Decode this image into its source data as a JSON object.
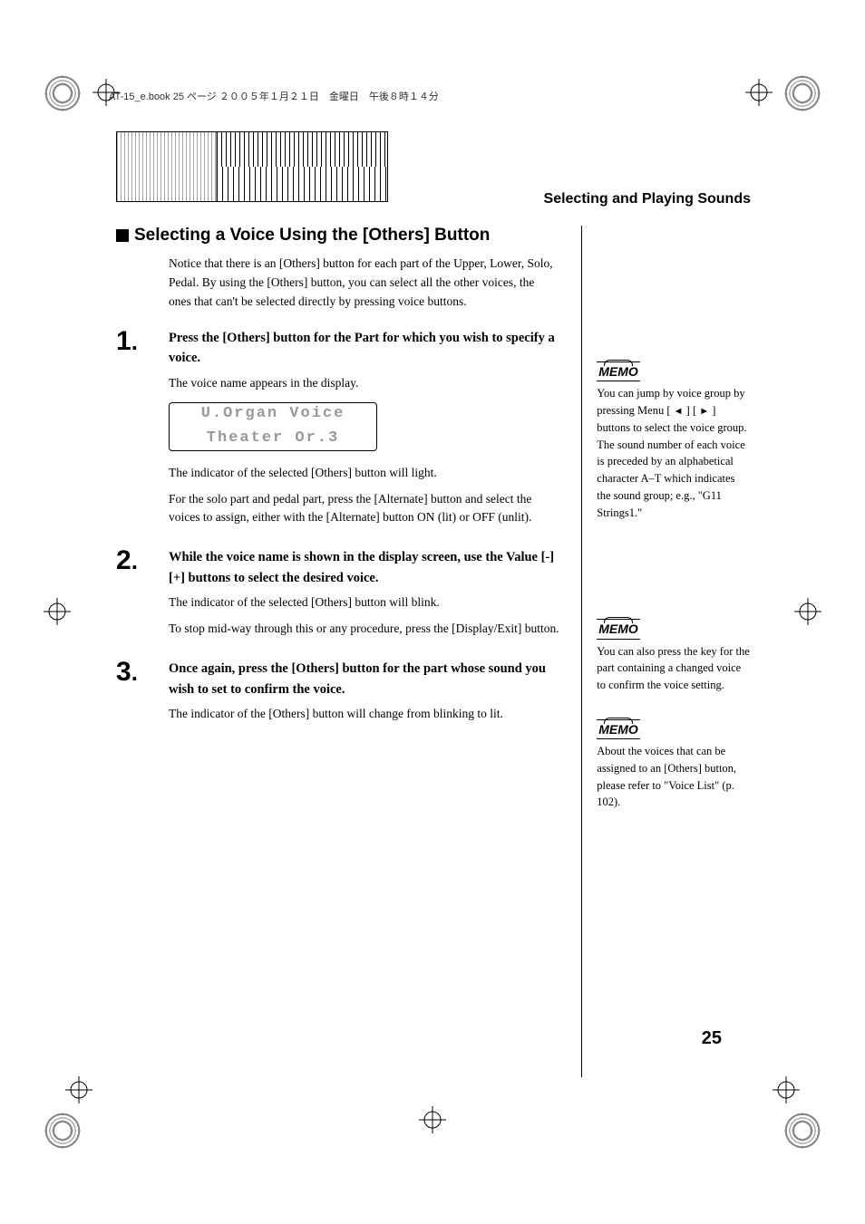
{
  "header_meta": "AT-15_e.book 25 ページ ２００５年１月２１日　金曜日　午後８時１４分",
  "chapter_title": "Selecting and Playing Sounds",
  "heading": "Selecting a Voice Using the [Others] Button",
  "intro": "Notice that there is an [Others] button for each part of the Upper, Lower, Solo, Pedal. By using the [Others] button, you can select all the other voices, the ones that can't be selected directly by pressing voice buttons.",
  "steps": [
    {
      "num": "1",
      "title": "Press the [Others] button for the Part for which you wish to specify a voice.",
      "body1": "The voice name appears in the display.",
      "lcd_line1": "U.Organ Voice",
      "lcd_line2": "Theater Or.3",
      "body2": "The indicator of the selected [Others] button will light.",
      "body3": "For the solo part and pedal part, press the [Alternate] button and select the voices to assign, either with the [Alternate] button ON (lit) or OFF (unlit)."
    },
    {
      "num": "2",
      "title": "While the voice name is shown in the display screen, use the Value [-] [+] buttons to select the desired voice.",
      "body1": "The indicator of the selected [Others] button will blink.",
      "body2": "To stop mid-way through this or any procedure, press the [Display/Exit] button."
    },
    {
      "num": "3",
      "title": "Once again, press the [Others] button for the part whose sound you wish to set to confirm the voice.",
      "body1": "The indicator of the [Others] button will change from blinking to lit."
    }
  ],
  "memo_label": "MEMO",
  "memos": [
    {
      "text_pre": "You can jump by voice group by pressing Menu [ ",
      "arrow_left": "◄",
      "text_mid": " ] [ ",
      "arrow_right": "►",
      "text_post": " ] buttons to select the voice group. The sound number of each voice is preceded by an alphabetical character A–T which indicates the sound group; e.g., \"G11 Strings1.\""
    },
    {
      "text": "You can also press the key for the part containing a changed voice to confirm the voice setting."
    },
    {
      "text": "About the voices that can be assigned to an [Others] button, please refer to \"Voice List\" (p. 102)."
    }
  ],
  "page_number": "25"
}
